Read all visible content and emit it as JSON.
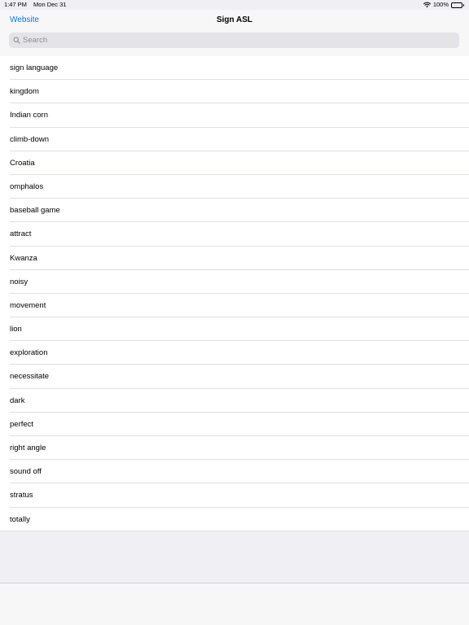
{
  "status": {
    "time": "1:47 PM",
    "date": "Mon Dec 31",
    "battery": "100%"
  },
  "nav": {
    "left_button": "Website",
    "title": "Sign ASL"
  },
  "search": {
    "placeholder": "Search"
  },
  "list": {
    "items": [
      "sign language",
      "kingdom",
      "Indian corn",
      "climb-down",
      "Croatia",
      "omphalos",
      "baseball game",
      "attract",
      "Kwanza",
      "noisy",
      "movement",
      "lion",
      "exploration",
      "necessitate",
      "dark",
      "perfect",
      "right angle",
      "sound off",
      "stratus",
      "totally"
    ]
  },
  "colors": {
    "accent": "#007aff",
    "background": "#efeff4"
  },
  "icons": {
    "search": "search-icon",
    "wifi": "wifi-icon",
    "battery": "battery-icon"
  }
}
